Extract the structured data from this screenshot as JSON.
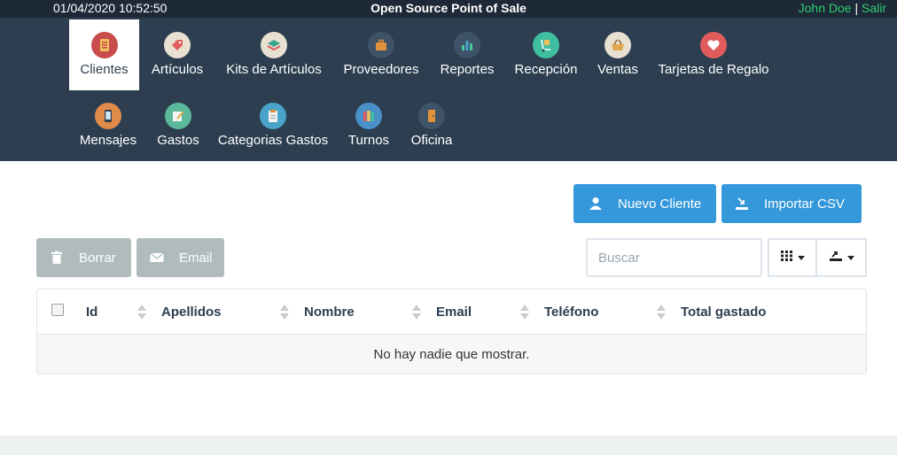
{
  "topbar": {
    "datetime": "01/04/2020 10:52:50",
    "app_title": "Open Source Point of Sale",
    "user_name": "John Doe",
    "separator": "|",
    "logout": "Salir"
  },
  "nav": {
    "items": [
      {
        "label": "Clientes",
        "icon": "customers-icon",
        "color": "#e05c5c"
      },
      {
        "label": "Artículos",
        "icon": "tag-icon",
        "color": "#e07a6b"
      },
      {
        "label": "Kits de Artículos",
        "icon": "layers-icon",
        "color": "#3aa58a"
      },
      {
        "label": "Proveedores",
        "icon": "briefcase-icon",
        "color": "#e0913a"
      },
      {
        "label": "Reportes",
        "icon": "bar-chart-icon",
        "color": "#4aa3c8"
      },
      {
        "label": "Recepción",
        "icon": "hand-truck-icon",
        "color": "#3fbfa0"
      },
      {
        "label": "Ventas",
        "icon": "basket-icon",
        "color": "#e0a84a"
      },
      {
        "label": "Tarjetas de Regalo",
        "icon": "heart-icon",
        "color": "#e05c5c"
      },
      {
        "label": "Mensajes",
        "icon": "phone-icon",
        "color": "#e08a4a"
      },
      {
        "label": "Gastos",
        "icon": "notepad-icon",
        "color": "#5bb89a"
      },
      {
        "label": "Categorias Gastos",
        "icon": "clipboard-icon",
        "color": "#4aa3c8"
      },
      {
        "label": "Turnos",
        "icon": "books-icon",
        "color": "#4a90c8"
      },
      {
        "label": "Oficina",
        "icon": "door-icon",
        "color": "#e0913a"
      }
    ]
  },
  "actions": {
    "new_customer": "Nuevo Cliente",
    "import_csv": "Importar CSV",
    "delete": "Borrar",
    "email": "Email"
  },
  "search": {
    "placeholder": "Buscar"
  },
  "table": {
    "columns": [
      "Id",
      "Apellidos",
      "Nombre",
      "Email",
      "Teléfono",
      "Total gastado"
    ],
    "empty_message": "No hay nadie que mostrar."
  },
  "colors": {
    "topbar": "#1d2937",
    "nav": "#2c3e50",
    "primary": "#3498db",
    "disabled": "#95a5a6",
    "user_link": "#2ecc71"
  }
}
